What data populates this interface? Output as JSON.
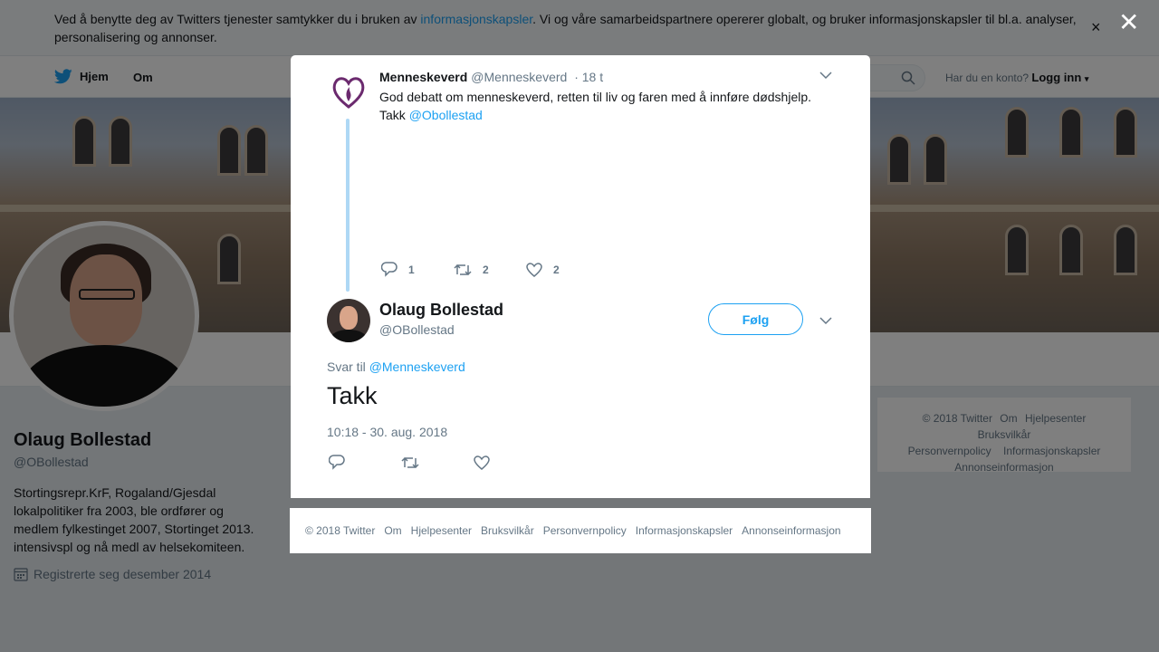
{
  "cookie_banner": {
    "text_before": "Ved å benytte deg av Twitters tjenester samtykker du i bruken av ",
    "link": "informasjonskapsler",
    "text_after": ". Vi og våre samarbeidspartnere opererer globalt, og bruker informasjonskapsler til bl.a. analyser, personalisering og annonser.",
    "close": "×"
  },
  "nav": {
    "home": "Hjem",
    "about": "Om",
    "account_prompt": "Har du en konto?",
    "login": "Logg inn"
  },
  "profile": {
    "name": "Olaug Bollestad",
    "handle": "@OBollestad",
    "bio": "Stortingsrepr.KrF, Rogaland/Gjesdal lokalpolitiker fra 2003, ble ordfører og medlem fylkestinget 2007, Stortinget 2013. intensivspl og nå medl av helsekomiteen.",
    "joined": "Registrerte seg desember 2014"
  },
  "side_footer": {
    "items": [
      "© 2018 Twitter",
      "Om",
      "Hjelpesenter",
      "Bruksvilkår",
      "Personvernpolicy",
      "Informasjonskapsler",
      "Annonseinformasjon"
    ]
  },
  "overlay": {
    "close": "✕"
  },
  "parent_tweet": {
    "name": "Menneskeverd",
    "handle": "@Menneskeverd",
    "time": "· 18 t",
    "text": "God debatt om menneskeverd, retten til liv og faren med å innføre dødshjelp. Takk ",
    "mention": "@Obollestad",
    "replies": "1",
    "retweets": "2",
    "likes": "2"
  },
  "main_tweet": {
    "name": "Olaug Bollestad",
    "handle": "@OBollestad",
    "follow": "Følg",
    "reply_prefix": "Svar til ",
    "reply_mention": "@Menneskeverd",
    "text": "Takk",
    "timestamp": "10:18 - 30. aug. 2018"
  },
  "modal_footer": {
    "items": [
      "© 2018 Twitter",
      "Om",
      "Hjelpesenter",
      "Bruksvilkår",
      "Personvernpolicy",
      "Informasjonskapsler",
      "Annonseinformasjon"
    ]
  },
  "colors": {
    "accent": "#1da1f2",
    "thread_line": "#aed8f5",
    "muted": "#657786"
  }
}
